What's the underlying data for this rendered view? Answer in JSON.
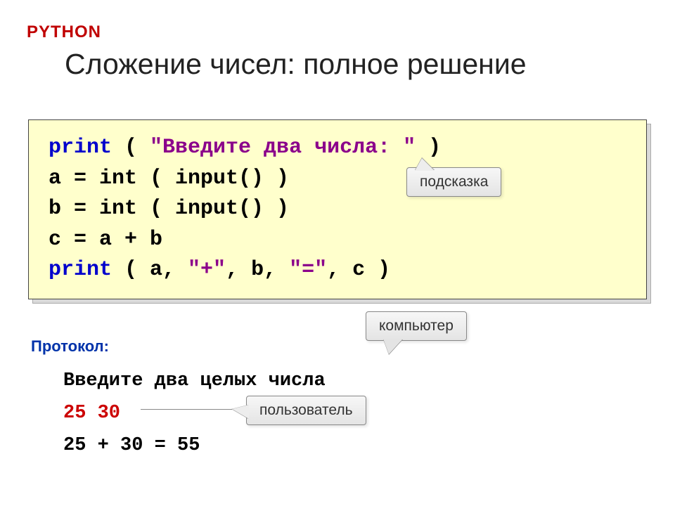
{
  "header": {
    "language": "PYTHON",
    "title": "Сложение чисел: полное решение"
  },
  "code": {
    "l1_print": "print",
    "l1_open": " ( ",
    "l1_str": "\"Введите два числа: \"",
    "l1_close": " )",
    "l2": "a = int ( input() )",
    "l3": "b = int ( input() )",
    "l4": "c = a + b",
    "l5_print": "print",
    "l5_mid1": " ( a, ",
    "l5_s1": "\"+\"",
    "l5_mid2": ", b, ",
    "l5_s2": "\"=\"",
    "l5_end": ", c )"
  },
  "callouts": {
    "hint": "подсказка",
    "computer": "компьютер",
    "user": "пользователь"
  },
  "protocol": {
    "label": "Протокол:",
    "line1": "Введите два целых числа",
    "line2": "25 30",
    "line3": "25 + 30 = 55"
  }
}
